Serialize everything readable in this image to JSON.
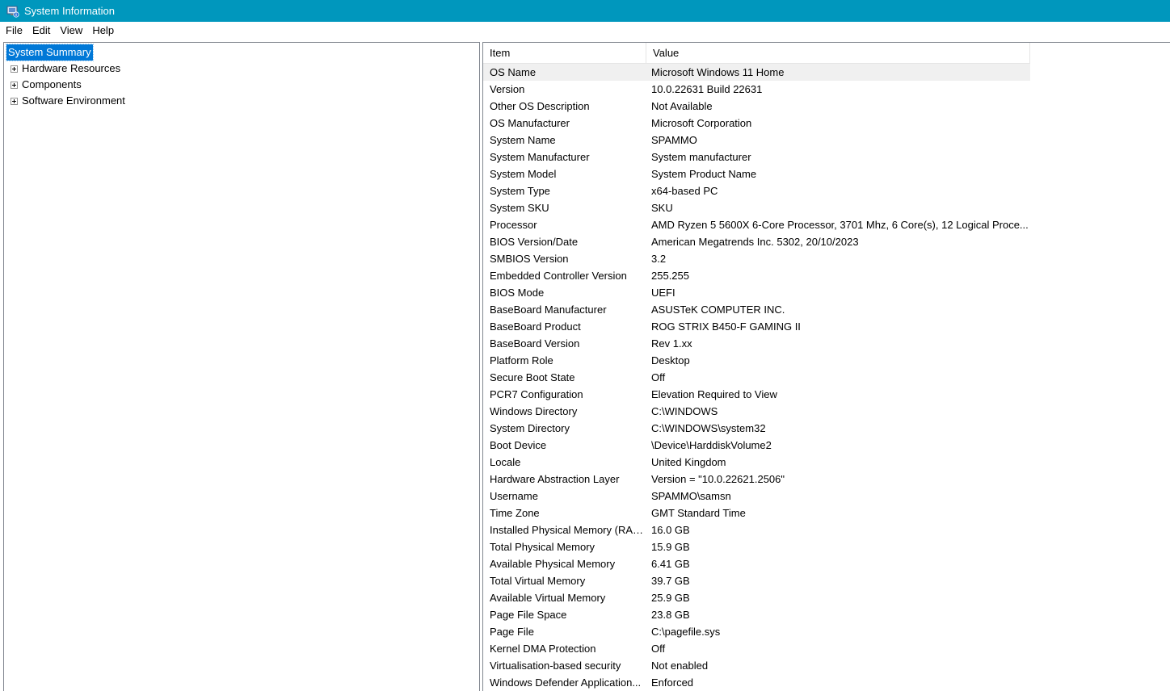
{
  "window": {
    "title": "System Information",
    "titlebar_color": "#0097bd",
    "icon": "system-information-icon"
  },
  "menu": {
    "file": "File",
    "edit": "Edit",
    "view": "View",
    "help": "Help"
  },
  "tree": {
    "selected": "System Summary",
    "children": [
      "Hardware Resources",
      "Components",
      "Software Environment"
    ],
    "selection_color": "#0078d7"
  },
  "table": {
    "headers": {
      "item": "Item",
      "value": "Value"
    },
    "rows": [
      {
        "item": "OS Name",
        "value": "Microsoft Windows 11 Home"
      },
      {
        "item": "Version",
        "value": "10.0.22631 Build 22631"
      },
      {
        "item": "Other OS Description",
        "value": "Not Available"
      },
      {
        "item": "OS Manufacturer",
        "value": "Microsoft Corporation"
      },
      {
        "item": "System Name",
        "value": "SPAMMO"
      },
      {
        "item": "System Manufacturer",
        "value": "System manufacturer"
      },
      {
        "item": "System Model",
        "value": "System Product Name"
      },
      {
        "item": "System Type",
        "value": "x64-based PC"
      },
      {
        "item": "System SKU",
        "value": "SKU"
      },
      {
        "item": "Processor",
        "value": "AMD Ryzen 5 5600X 6-Core Processor, 3701 Mhz, 6 Core(s), 12 Logical Proce..."
      },
      {
        "item": "BIOS Version/Date",
        "value": "American Megatrends Inc. 5302, 20/10/2023"
      },
      {
        "item": "SMBIOS Version",
        "value": "3.2"
      },
      {
        "item": "Embedded Controller Version",
        "value": "255.255"
      },
      {
        "item": "BIOS Mode",
        "value": "UEFI"
      },
      {
        "item": "BaseBoard Manufacturer",
        "value": "ASUSTeK COMPUTER INC."
      },
      {
        "item": "BaseBoard Product",
        "value": "ROG STRIX B450-F GAMING II"
      },
      {
        "item": "BaseBoard Version",
        "value": "Rev 1.xx"
      },
      {
        "item": "Platform Role",
        "value": "Desktop"
      },
      {
        "item": "Secure Boot State",
        "value": "Off"
      },
      {
        "item": "PCR7 Configuration",
        "value": "Elevation Required to View"
      },
      {
        "item": "Windows Directory",
        "value": "C:\\WINDOWS"
      },
      {
        "item": "System Directory",
        "value": "C:\\WINDOWS\\system32"
      },
      {
        "item": "Boot Device",
        "value": "\\Device\\HarddiskVolume2"
      },
      {
        "item": "Locale",
        "value": "United Kingdom"
      },
      {
        "item": "Hardware Abstraction Layer",
        "value": "Version = \"10.0.22621.2506\""
      },
      {
        "item": "Username",
        "value": "SPAMMO\\samsn"
      },
      {
        "item": "Time Zone",
        "value": "GMT Standard Time"
      },
      {
        "item": "Installed Physical Memory (RAM)",
        "value": "16.0 GB"
      },
      {
        "item": "Total Physical Memory",
        "value": "15.9 GB"
      },
      {
        "item": "Available Physical Memory",
        "value": "6.41 GB"
      },
      {
        "item": "Total Virtual Memory",
        "value": "39.7 GB"
      },
      {
        "item": "Available Virtual Memory",
        "value": "25.9 GB"
      },
      {
        "item": "Page File Space",
        "value": "23.8 GB"
      },
      {
        "item": "Page File",
        "value": "C:\\pagefile.sys"
      },
      {
        "item": "Kernel DMA Protection",
        "value": "Off"
      },
      {
        "item": "Virtualisation-based security",
        "value": "Not enabled"
      },
      {
        "item": "Windows Defender Application...",
        "value": "Enforced"
      }
    ]
  }
}
